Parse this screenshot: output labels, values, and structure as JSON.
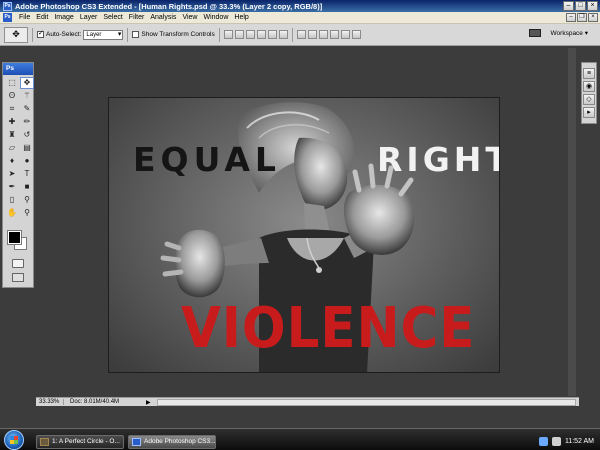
{
  "window": {
    "title": "Adobe Photoshop CS3 Extended - [Human Rights.psd @ 33.3% (Layer 2 copy, RGB/8)]",
    "app_icon": "Ps"
  },
  "menu": [
    "File",
    "Edit",
    "Image",
    "Layer",
    "Select",
    "Filter",
    "Analysis",
    "View",
    "Window",
    "Help"
  ],
  "options_bar": {
    "auto_select_label": "Auto-Select:",
    "auto_select_checked": true,
    "auto_select_value": "Layer",
    "show_transform_label": "Show Transform Controls",
    "show_transform_checked": false,
    "workspace_label": "Workspace ▾"
  },
  "toolbox": {
    "header": "Ps",
    "tools": [
      "marquee-tool",
      "move-tool",
      "lasso-tool",
      "magic-wand-tool",
      "crop-tool",
      "slice-tool",
      "healing-brush-tool",
      "brush-tool",
      "clone-stamp-tool",
      "history-brush-tool",
      "eraser-tool",
      "gradient-tool",
      "blur-tool",
      "dodge-tool",
      "path-selection-tool",
      "type-tool",
      "pen-tool",
      "custom-shape-tool",
      "notes-tool",
      "eyedropper-tool",
      "hand-tool",
      "zoom-tool"
    ],
    "foreground_color": "#000000",
    "background_color": "#ffffff"
  },
  "canvas": {
    "word_equal": "EQUAL",
    "word_rights": "RIGHTS",
    "word_violence": "VIOLENCE",
    "violence_color": "#c81b1b"
  },
  "status": {
    "zoom": "33.33%",
    "doc": "Doc: 8.01M/40.4M"
  },
  "taskbar": {
    "tasks": [
      "1: A Perfect Circle - O...",
      "Adobe Photoshop CS3..."
    ],
    "clock": "11:52 AM"
  }
}
